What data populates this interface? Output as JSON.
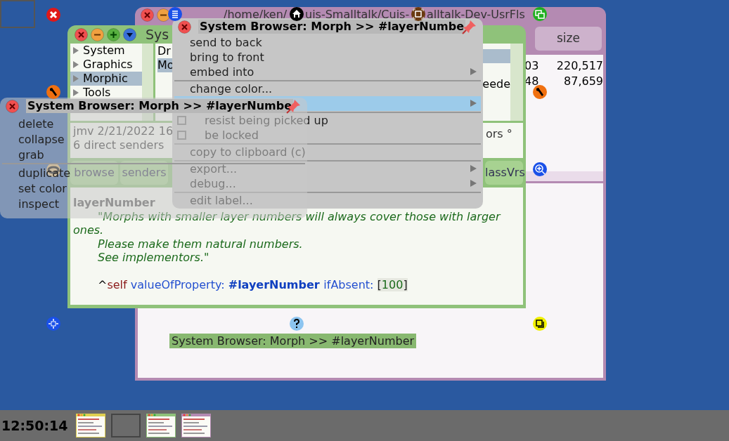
{
  "file_window": {
    "title_parts": [
      "/home/ken/",
      "uis-Smalltalk/Cuis-",
      "alltalk-Dev-UsrFls"
    ],
    "column_header": "size",
    "rows": [
      {
        "column_1": "03",
        "column_2": "220,517"
      },
      {
        "column_1": "48",
        "column_2": "87,659"
      }
    ],
    "label": "System Browser: Morph >> #layerNumber"
  },
  "browser": {
    "title": "Sys",
    "categories": [
      {
        "label": "System",
        "selected": false
      },
      {
        "label": "Graphics",
        "selected": false
      },
      {
        "label": "Morphic",
        "selected": true
      },
      {
        "label": "Tools",
        "selected": false
      }
    ],
    "classes": [
      {
        "label": "Dr",
        "selected": false
      },
      {
        "label": "Mo",
        "selected": true
      }
    ],
    "methods": [
      {
        "selected": true
      },
      {
        "selected": false
      },
      {
        "label": "eede",
        "selected": false
      }
    ],
    "info": {
      "line_1": "jmv 2/21/2022 16",
      "line_2": "6 direct senders",
      "line_2_tail": "ors °"
    },
    "buttons": [
      {
        "label": "browse"
      },
      {
        "label": "senders"
      },
      {
        "label": "lassVrs"
      }
    ],
    "code": {
      "header": "layerNumber",
      "comment": [
        {
          "text": "\"Morphs with smaller layer numbers will always cover those with larger",
          "indent": true
        },
        {
          "text": "ones.",
          "indent": false
        },
        {
          "text": "Please make them natural numbers.",
          "indent": true
        },
        {
          "text": "See implementors.\"",
          "indent": true
        }
      ],
      "statement": [
        {
          "kind": "caret",
          "text": "^"
        },
        {
          "kind": "self",
          "text": "self"
        },
        {
          "kind": "keyword",
          "text": "valueOfProperty:"
        },
        {
          "kind": "symbol",
          "text": "#layerNumber"
        },
        {
          "kind": "keyword",
          "text": "ifAbsent:"
        },
        {
          "kind": "bracket",
          "text": "["
        },
        {
          "kind": "number",
          "text": "100"
        },
        {
          "kind": "bracket",
          "text": "]"
        }
      ]
    }
  },
  "menu_1": {
    "title": "System Browser: Morph >> #layerNumbe",
    "items": [
      {
        "kind": "item",
        "label": "send to back",
        "submenu": false,
        "selected": false
      },
      {
        "kind": "item",
        "label": "bring to front",
        "submenu": false,
        "selected": false
      },
      {
        "kind": "item",
        "label": "embed into",
        "submenu": true,
        "selected": false
      },
      {
        "kind": "separator"
      },
      {
        "kind": "item",
        "label": "change color...",
        "submenu": false,
        "selected": false
      },
      {
        "kind": "item",
        "submenu": true,
        "selected": true
      },
      {
        "kind": "separator"
      },
      {
        "kind": "checkbox",
        "label": "resist being picked up",
        "checked": false
      },
      {
        "kind": "checkbox",
        "label": "be locked",
        "checked": false
      },
      {
        "kind": "separator"
      },
      {
        "kind": "item",
        "label": "copy to clipboard (c)",
        "submenu": false,
        "selected": false
      },
      {
        "kind": "separator"
      },
      {
        "kind": "item",
        "label": "export...",
        "submenu": true,
        "selected": false
      },
      {
        "kind": "item",
        "label": "debug...",
        "submenu": true,
        "selected": false
      },
      {
        "kind": "separator"
      },
      {
        "kind": "item",
        "label": "edit label...",
        "submenu": false,
        "selected": false
      }
    ]
  },
  "menu_2": {
    "title": "System Browser: Morph >> #layerNumbe",
    "items": [
      {
        "kind": "item",
        "label": "delete"
      },
      {
        "kind": "item",
        "label": "collapse"
      },
      {
        "kind": "item",
        "label": "grab"
      },
      {
        "kind": "separator"
      },
      {
        "kind": "item",
        "label": "duplicate"
      },
      {
        "kind": "item",
        "label": "set color"
      },
      {
        "kind": "item",
        "label": "inspect"
      }
    ]
  },
  "taskbar": {
    "clock": "12:50:14",
    "thumbnails": [
      {
        "kind": "workspace"
      },
      {
        "kind": "empty"
      },
      {
        "kind": "browser"
      },
      {
        "kind": "file_list"
      }
    ]
  }
}
